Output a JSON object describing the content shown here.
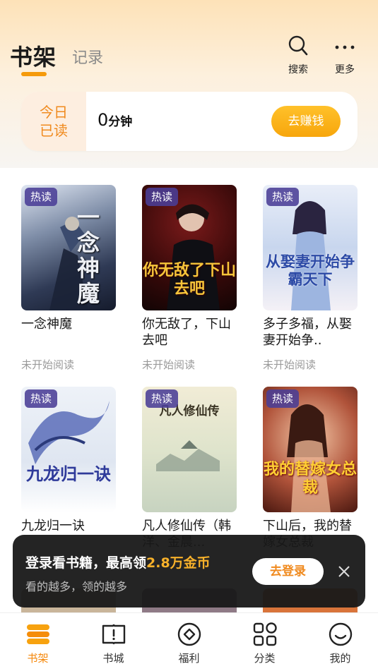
{
  "header": {
    "tab_shelf": "书架",
    "tab_record": "记录",
    "search_label": "搜索",
    "more_label": "更多"
  },
  "today": {
    "label_line1": "今日",
    "label_line2": "已读",
    "value": "0",
    "unit": "分钟",
    "earn_button": "去赚钱"
  },
  "books": [
    {
      "title": "一念神魔",
      "status": "未开始阅读",
      "badge": "热读",
      "cover_text": "一念神魔"
    },
    {
      "title": "你无敌了，下山去吧",
      "status": "未开始阅读",
      "badge": "热读",
      "cover_text": "你无敌了下山去吧"
    },
    {
      "title": "多子多福，从娶妻开始争..",
      "status": "未开始阅读",
      "badge": "热读",
      "cover_text": "从娶妻开始争霸天下"
    },
    {
      "title": "九龙归一诀",
      "status": "",
      "badge": "热读",
      "cover_text": "九龙归一诀"
    },
    {
      "title": "凡人修仙传（韩洋、金晨...",
      "status": "",
      "badge": "热读",
      "cover_text": "凡人修仙传"
    },
    {
      "title": "下山后，我的替嫁女总裁",
      "status": "",
      "badge": "热读",
      "cover_text": "我的替嫁女总裁"
    }
  ],
  "login_toast": {
    "main_prefix": "登录看书籍，最高领",
    "main_highlight": "2.8万金币",
    "sub": "看的越多，领的越多",
    "button": "去登录"
  },
  "bottom_nav": [
    {
      "label": "书架",
      "icon": "bookshelf-icon",
      "active": true
    },
    {
      "label": "书城",
      "icon": "book-city-icon",
      "active": false
    },
    {
      "label": "福利",
      "icon": "welfare-icon",
      "active": false
    },
    {
      "label": "分类",
      "icon": "category-icon",
      "active": false
    },
    {
      "label": "我的",
      "icon": "profile-icon",
      "active": false
    }
  ],
  "colors": {
    "accent": "#f5870a",
    "badge": "#4a3e96"
  }
}
